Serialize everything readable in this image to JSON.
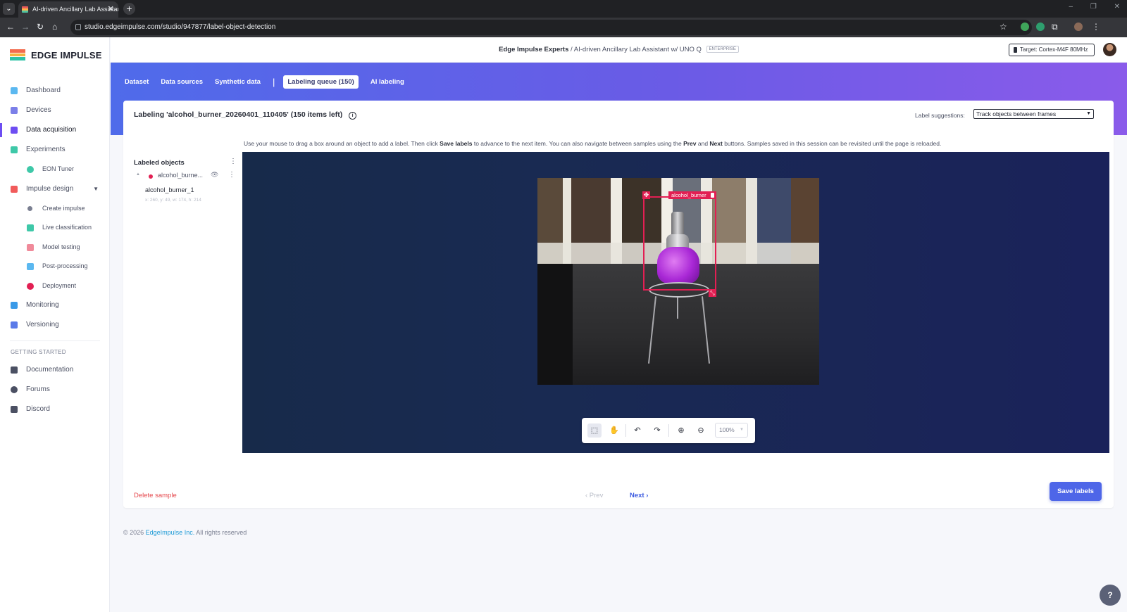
{
  "browser": {
    "tab_title": "AI-driven Ancillary Lab Assistan",
    "tab_close": "✕",
    "new_tab": "+",
    "url": "studio.edgeimpulse.com/studio/947877/label-object-detection",
    "window_controls": [
      "–",
      "❐",
      "✕"
    ]
  },
  "sidebar": {
    "logo_text": "EDGE IMPULSE",
    "items": [
      {
        "label": "Dashboard",
        "icon": "monitor-icon",
        "color": "#5bb8f0"
      },
      {
        "label": "Devices",
        "icon": "device-icon",
        "color": "#7b7fe8"
      },
      {
        "label": "Data acquisition",
        "icon": "database-icon",
        "color": "#6d4df2"
      },
      {
        "label": "Experiments",
        "icon": "grid-icon",
        "color": "#3ec8a8"
      },
      {
        "label": "EON Tuner",
        "icon": "tuner-icon",
        "color": "#3ec8a8"
      },
      {
        "label": "Impulse design",
        "icon": "pulse-icon",
        "color": "#f15b5b"
      },
      {
        "label": "Create impulse",
        "icon": "dot-icon",
        "color": "#7a7f91"
      },
      {
        "label": "Live classification",
        "icon": "live-icon",
        "color": "#3ec8a8"
      },
      {
        "label": "Model testing",
        "icon": "test-icon",
        "color": "#f08a9a"
      },
      {
        "label": "Post-processing",
        "icon": "post-icon",
        "color": "#5bb8f0"
      },
      {
        "label": "Deployment",
        "icon": "deploy-icon",
        "color": "#e21f53"
      },
      {
        "label": "Monitoring",
        "icon": "monitoring-icon",
        "color": "#3a9ae8"
      },
      {
        "label": "Versioning",
        "icon": "branch-icon",
        "color": "#5a7ae8"
      }
    ],
    "section_title": "GETTING STARTED",
    "help_items": [
      {
        "label": "Documentation",
        "icon": "doc-icon"
      },
      {
        "label": "Forums",
        "icon": "forum-icon"
      },
      {
        "label": "Discord",
        "icon": "discord-icon"
      }
    ]
  },
  "header": {
    "org": "Edge Impulse Experts",
    "separator": "/",
    "project": "AI-driven Ancillary Lab Assistant w/ UNO Q",
    "badge": "ENTERPRISE",
    "target": "Target: Cortex-M4F 80MHz"
  },
  "subnav": {
    "tabs": [
      "Dataset",
      "Data sources",
      "Synthetic data"
    ],
    "separator": "|",
    "active_tab": "Labeling queue (150)",
    "last_tab": "AI labeling"
  },
  "labeling": {
    "title": "Labeling 'alcohol_burner_20260401_110405' (150 items left)",
    "info_icon": "i",
    "suggestions_label": "Label suggestions:",
    "suggestions_value": "Track objects between frames",
    "instructions": {
      "p1": "Use your mouse to drag a box around an object to add a label. Then click ",
      "b1": "Save labels",
      "p2": " to advance to the next item. You can also navigate between samples using the ",
      "b2": "Prev",
      "p3": " and ",
      "b3": "Next",
      "p4": " buttons. Samples saved in this session can be revisited until the page is reloaded."
    },
    "labeled_objects_title": "Labeled objects",
    "label_group": "alcohol_burne...",
    "label_color": "#e21f53",
    "label_instance": "alcohol_burner_1",
    "label_coords": "x: 260, y: 49, w: 174, h: 214",
    "bbox_label": "alcohol_burner",
    "zoom": "100%",
    "delete": "Delete sample",
    "prev": "‹  Prev",
    "next": "Next  ›",
    "save": "Save labels"
  },
  "footer": {
    "copyright": "© 2026 ",
    "company": "EdgeImpulse Inc.",
    "rights": " All rights reserved"
  },
  "colors": {
    "accent": "#6d4df2",
    "primary_button": "#4e66e8",
    "danger": "#e5484d",
    "label": "#e21f53"
  }
}
